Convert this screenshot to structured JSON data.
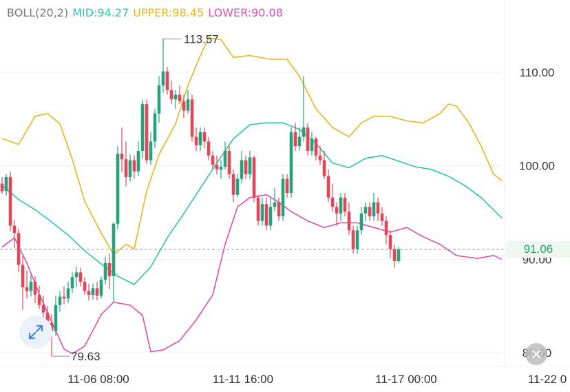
{
  "legend": {
    "indicator": "BOLL(20,2)",
    "mid": "MID:94.27",
    "upper": "UPPER:98.45",
    "lower": "LOWER:90.08"
  },
  "colors": {
    "up": "#26a17b",
    "down": "#e0485a",
    "mid": "#2cc3a8",
    "upper": "#e8b41e",
    "lower": "#d84fb0",
    "grid": "#eeeeee",
    "axis_text": "#333333",
    "indicator_text": "#777777",
    "current_price": "#2a9d6a"
  },
  "annotations": {
    "high": "113.57",
    "low": "79.63",
    "current_price": "91.06"
  },
  "icons": {
    "expand": "expand-arrows-icon",
    "reset": "reset-icon"
  },
  "chart_data": {
    "type": "candlestick",
    "y_ticks": [
      "110.00",
      "100.00",
      "90.00",
      "80.00"
    ],
    "x_ticks": [
      "11-06 08:00",
      "11-11 16:00",
      "11-17 00:00",
      "11-22 0"
    ],
    "ylim": [
      79,
      116
    ],
    "grid": true,
    "current_price": 91.06,
    "high": 113.57,
    "low": 79.63,
    "candles": [
      {
        "o": 98.1,
        "h": 98.8,
        "l": 97.0,
        "c": 97.3
      },
      {
        "o": 97.3,
        "h": 99.1,
        "l": 96.8,
        "c": 98.8
      },
      {
        "o": 98.8,
        "h": 99.4,
        "l": 93.0,
        "c": 93.6
      },
      {
        "o": 93.6,
        "h": 94.2,
        "l": 91.2,
        "c": 92.8
      },
      {
        "o": 92.8,
        "h": 93.3,
        "l": 88.6,
        "c": 89.4
      },
      {
        "o": 89.4,
        "h": 90.3,
        "l": 84.6,
        "c": 87.0
      },
      {
        "o": 87.0,
        "h": 88.8,
        "l": 85.8,
        "c": 86.6
      },
      {
        "o": 86.6,
        "h": 88.3,
        "l": 86.0,
        "c": 87.6
      },
      {
        "o": 87.6,
        "h": 88.2,
        "l": 85.3,
        "c": 86.2
      },
      {
        "o": 86.2,
        "h": 87.2,
        "l": 84.7,
        "c": 85.1
      },
      {
        "o": 85.1,
        "h": 86.1,
        "l": 83.5,
        "c": 84.3
      },
      {
        "o": 84.3,
        "h": 85.0,
        "l": 82.2,
        "c": 83.2
      },
      {
        "o": 83.2,
        "h": 84.1,
        "l": 79.6,
        "c": 82.3
      },
      {
        "o": 82.3,
        "h": 86.1,
        "l": 81.8,
        "c": 85.1
      },
      {
        "o": 85.1,
        "h": 86.6,
        "l": 84.4,
        "c": 86.0
      },
      {
        "o": 86.0,
        "h": 87.1,
        "l": 85.2,
        "c": 85.8
      },
      {
        "o": 85.8,
        "h": 87.6,
        "l": 85.3,
        "c": 86.9
      },
      {
        "o": 86.9,
        "h": 88.6,
        "l": 86.4,
        "c": 88.1
      },
      {
        "o": 88.1,
        "h": 89.2,
        "l": 87.0,
        "c": 88.6
      },
      {
        "o": 88.6,
        "h": 89.1,
        "l": 87.1,
        "c": 87.6
      },
      {
        "o": 87.6,
        "h": 88.1,
        "l": 86.2,
        "c": 86.6
      },
      {
        "o": 86.6,
        "h": 87.4,
        "l": 85.6,
        "c": 86.2
      },
      {
        "o": 86.2,
        "h": 87.4,
        "l": 85.7,
        "c": 86.9
      },
      {
        "o": 86.9,
        "h": 87.6,
        "l": 85.6,
        "c": 86.1
      },
      {
        "o": 86.1,
        "h": 88.2,
        "l": 85.8,
        "c": 87.8
      },
      {
        "o": 87.8,
        "h": 90.3,
        "l": 87.3,
        "c": 89.6
      },
      {
        "o": 89.6,
        "h": 90.6,
        "l": 86.8,
        "c": 88.2
      },
      {
        "o": 88.2,
        "h": 94.0,
        "l": 85.3,
        "c": 93.8
      },
      {
        "o": 93.8,
        "h": 102.1,
        "l": 93.2,
        "c": 101.3
      },
      {
        "o": 101.3,
        "h": 104.1,
        "l": 99.3,
        "c": 100.7
      },
      {
        "o": 100.7,
        "h": 102.6,
        "l": 97.8,
        "c": 98.8
      },
      {
        "o": 98.8,
        "h": 101.2,
        "l": 98.3,
        "c": 100.6
      },
      {
        "o": 100.6,
        "h": 101.1,
        "l": 98.6,
        "c": 99.4
      },
      {
        "o": 99.4,
        "h": 102.6,
        "l": 98.9,
        "c": 101.6
      },
      {
        "o": 101.6,
        "h": 107.1,
        "l": 100.8,
        "c": 106.6
      },
      {
        "o": 106.6,
        "h": 107.1,
        "l": 100.2,
        "c": 100.6
      },
      {
        "o": 100.6,
        "h": 103.6,
        "l": 100.1,
        "c": 102.6
      },
      {
        "o": 102.6,
        "h": 106.1,
        "l": 101.9,
        "c": 105.6
      },
      {
        "o": 105.6,
        "h": 109.6,
        "l": 104.6,
        "c": 108.6
      },
      {
        "o": 108.6,
        "h": 113.6,
        "l": 107.8,
        "c": 110.1
      },
      {
        "o": 110.1,
        "h": 110.6,
        "l": 107.6,
        "c": 108.1
      },
      {
        "o": 108.1,
        "h": 109.1,
        "l": 106.6,
        "c": 107.1
      },
      {
        "o": 107.1,
        "h": 108.1,
        "l": 106.1,
        "c": 107.6
      },
      {
        "o": 107.6,
        "h": 108.6,
        "l": 106.6,
        "c": 106.9
      },
      {
        "o": 106.9,
        "h": 107.6,
        "l": 105.1,
        "c": 105.9
      },
      {
        "o": 105.9,
        "h": 108.1,
        "l": 105.6,
        "c": 107.1
      },
      {
        "o": 107.1,
        "h": 107.6,
        "l": 102.6,
        "c": 103.1
      },
      {
        "o": 103.1,
        "h": 104.1,
        "l": 101.6,
        "c": 102.2
      },
      {
        "o": 102.2,
        "h": 104.1,
        "l": 101.6,
        "c": 103.6
      },
      {
        "o": 103.6,
        "h": 104.1,
        "l": 101.9,
        "c": 102.6
      },
      {
        "o": 102.6,
        "h": 103.1,
        "l": 100.6,
        "c": 101.1
      },
      {
        "o": 101.1,
        "h": 101.6,
        "l": 99.6,
        "c": 100.1
      },
      {
        "o": 100.1,
        "h": 101.1,
        "l": 99.1,
        "c": 99.6
      },
      {
        "o": 99.6,
        "h": 100.6,
        "l": 98.6,
        "c": 99.9
      },
      {
        "o": 99.9,
        "h": 102.6,
        "l": 99.6,
        "c": 101.6
      },
      {
        "o": 101.6,
        "h": 102.1,
        "l": 98.6,
        "c": 99.1
      },
      {
        "o": 99.1,
        "h": 99.6,
        "l": 96.1,
        "c": 96.9
      },
      {
        "o": 96.9,
        "h": 99.1,
        "l": 96.6,
        "c": 98.6
      },
      {
        "o": 98.6,
        "h": 101.6,
        "l": 98.1,
        "c": 100.6
      },
      {
        "o": 100.6,
        "h": 101.1,
        "l": 98.6,
        "c": 99.1
      },
      {
        "o": 99.1,
        "h": 101.6,
        "l": 98.6,
        "c": 100.9
      },
      {
        "o": 100.9,
        "h": 101.1,
        "l": 96.1,
        "c": 96.6
      },
      {
        "o": 96.6,
        "h": 96.9,
        "l": 93.6,
        "c": 94.1
      },
      {
        "o": 94.1,
        "h": 96.6,
        "l": 93.6,
        "c": 95.9
      },
      {
        "o": 95.9,
        "h": 96.6,
        "l": 93.1,
        "c": 93.6
      },
      {
        "o": 93.6,
        "h": 96.6,
        "l": 93.1,
        "c": 95.6
      },
      {
        "o": 95.6,
        "h": 97.6,
        "l": 95.1,
        "c": 96.1
      },
      {
        "o": 96.1,
        "h": 96.6,
        "l": 94.1,
        "c": 94.6
      },
      {
        "o": 94.6,
        "h": 99.1,
        "l": 94.1,
        "c": 98.6
      },
      {
        "o": 98.6,
        "h": 99.1,
        "l": 96.6,
        "c": 97.1
      },
      {
        "o": 97.1,
        "h": 104.1,
        "l": 96.6,
        "c": 103.6
      },
      {
        "o": 103.6,
        "h": 104.6,
        "l": 101.6,
        "c": 102.1
      },
      {
        "o": 102.1,
        "h": 104.1,
        "l": 101.6,
        "c": 103.1
      },
      {
        "o": 103.1,
        "h": 109.6,
        "l": 102.6,
        "c": 104.1
      },
      {
        "o": 104.1,
        "h": 104.6,
        "l": 101.1,
        "c": 101.6
      },
      {
        "o": 101.6,
        "h": 103.6,
        "l": 101.1,
        "c": 102.9
      },
      {
        "o": 102.9,
        "h": 103.1,
        "l": 100.6,
        "c": 101.1
      },
      {
        "o": 101.1,
        "h": 102.1,
        "l": 100.1,
        "c": 100.6
      },
      {
        "o": 100.6,
        "h": 101.6,
        "l": 98.6,
        "c": 98.9
      },
      {
        "o": 98.9,
        "h": 99.6,
        "l": 96.1,
        "c": 96.6
      },
      {
        "o": 96.6,
        "h": 98.1,
        "l": 95.1,
        "c": 95.6
      },
      {
        "o": 95.6,
        "h": 96.1,
        "l": 93.6,
        "c": 94.9
      },
      {
        "o": 94.9,
        "h": 97.1,
        "l": 94.1,
        "c": 96.6
      },
      {
        "o": 96.6,
        "h": 97.1,
        "l": 94.6,
        "c": 95.1
      },
      {
        "o": 95.1,
        "h": 96.1,
        "l": 92.6,
        "c": 93.1
      },
      {
        "o": 93.1,
        "h": 93.6,
        "l": 90.6,
        "c": 91.1
      },
      {
        "o": 91.1,
        "h": 93.6,
        "l": 90.6,
        "c": 93.1
      },
      {
        "o": 93.1,
        "h": 95.6,
        "l": 92.6,
        "c": 94.9
      },
      {
        "o": 94.9,
        "h": 96.1,
        "l": 94.1,
        "c": 95.6
      },
      {
        "o": 95.6,
        "h": 96.1,
        "l": 94.1,
        "c": 94.6
      },
      {
        "o": 94.6,
        "h": 97.1,
        "l": 94.1,
        "c": 96.1
      },
      {
        "o": 96.1,
        "h": 96.6,
        "l": 94.1,
        "c": 94.9
      },
      {
        "o": 94.9,
        "h": 95.6,
        "l": 93.6,
        "c": 94.1
      },
      {
        "o": 94.1,
        "h": 94.6,
        "l": 91.6,
        "c": 92.6
      },
      {
        "o": 92.6,
        "h": 93.1,
        "l": 90.1,
        "c": 91.1
      },
      {
        "o": 91.1,
        "h": 91.6,
        "l": 89.1,
        "c": 89.8
      },
      {
        "o": 89.8,
        "h": 91.3,
        "l": 89.6,
        "c": 91.06
      }
    ],
    "upper": [
      {
        "i": 0,
        "v": 102.9
      },
      {
        "i": 4,
        "v": 102.3
      },
      {
        "i": 8,
        "v": 105.3
      },
      {
        "i": 11,
        "v": 105.6
      },
      {
        "i": 14,
        "v": 104.5
      },
      {
        "i": 17,
        "v": 100.7
      },
      {
        "i": 20,
        "v": 96.2
      },
      {
        "i": 24,
        "v": 92.8
      },
      {
        "i": 27,
        "v": 90.5
      },
      {
        "i": 30,
        "v": 91.6
      },
      {
        "i": 32,
        "v": 91.1
      },
      {
        "i": 35,
        "v": 97.3
      },
      {
        "i": 38,
        "v": 101.2
      },
      {
        "i": 42,
        "v": 104.5
      },
      {
        "i": 45,
        "v": 108.6
      },
      {
        "i": 48,
        "v": 111.8
      },
      {
        "i": 50,
        "v": 113.7
      },
      {
        "i": 53,
        "v": 113.5
      },
      {
        "i": 56,
        "v": 111.6
      },
      {
        "i": 60,
        "v": 111.8
      },
      {
        "i": 65,
        "v": 111.4
      },
      {
        "i": 69,
        "v": 111.4
      },
      {
        "i": 72,
        "v": 109.6
      },
      {
        "i": 76,
        "v": 106.1
      },
      {
        "i": 80,
        "v": 104.1
      },
      {
        "i": 84,
        "v": 103.1
      },
      {
        "i": 87,
        "v": 104.6
      },
      {
        "i": 90,
        "v": 105.3
      },
      {
        "i": 94,
        "v": 105.3
      },
      {
        "i": 98,
        "v": 104.8
      },
      {
        "i": 102,
        "v": 104.6
      },
      {
        "i": 106,
        "v": 105.6
      },
      {
        "i": 108,
        "v": 106.6
      },
      {
        "i": 110,
        "v": 106.4
      },
      {
        "i": 113,
        "v": 104.6
      },
      {
        "i": 116,
        "v": 102.1
      },
      {
        "i": 119,
        "v": 99.1
      },
      {
        "i": 121,
        "v": 98.4
      }
    ],
    "mid": [
      {
        "i": 0,
        "v": 97.9
      },
      {
        "i": 4,
        "v": 96.4
      },
      {
        "i": 8,
        "v": 95.3
      },
      {
        "i": 12,
        "v": 94.0
      },
      {
        "i": 16,
        "v": 92.6
      },
      {
        "i": 20,
        "v": 90.9
      },
      {
        "i": 24,
        "v": 89.5
      },
      {
        "i": 28,
        "v": 88.2
      },
      {
        "i": 32,
        "v": 87.3
      },
      {
        "i": 36,
        "v": 89.2
      },
      {
        "i": 40,
        "v": 92.3
      },
      {
        "i": 44,
        "v": 94.9
      },
      {
        "i": 48,
        "v": 97.6
      },
      {
        "i": 52,
        "v": 100.3
      },
      {
        "i": 56,
        "v": 102.9
      },
      {
        "i": 60,
        "v": 104.4
      },
      {
        "i": 64,
        "v": 104.6
      },
      {
        "i": 68,
        "v": 104.6
      },
      {
        "i": 72,
        "v": 103.9
      },
      {
        "i": 76,
        "v": 102.4
      },
      {
        "i": 80,
        "v": 100.3
      },
      {
        "i": 84,
        "v": 99.8
      },
      {
        "i": 88,
        "v": 100.8
      },
      {
        "i": 92,
        "v": 101.1
      },
      {
        "i": 96,
        "v": 100.5
      },
      {
        "i": 100,
        "v": 99.9
      },
      {
        "i": 104,
        "v": 99.6
      },
      {
        "i": 108,
        "v": 98.9
      },
      {
        "i": 112,
        "v": 97.9
      },
      {
        "i": 116,
        "v": 96.6
      },
      {
        "i": 121,
        "v": 94.4
      }
    ],
    "lower": [
      {
        "i": 0,
        "v": 91.3
      },
      {
        "i": 3,
        "v": 92.3
      },
      {
        "i": 6,
        "v": 89.6
      },
      {
        "i": 9,
        "v": 86.3
      },
      {
        "i": 12,
        "v": 83.3
      },
      {
        "i": 15,
        "v": 80.4
      },
      {
        "i": 17,
        "v": 79.9
      },
      {
        "i": 20,
        "v": 80.7
      },
      {
        "i": 24,
        "v": 84.1
      },
      {
        "i": 27,
        "v": 85.4
      },
      {
        "i": 31,
        "v": 85.1
      },
      {
        "i": 34,
        "v": 84.0
      },
      {
        "i": 36,
        "v": 80.1
      },
      {
        "i": 39,
        "v": 80.3
      },
      {
        "i": 43,
        "v": 81.3
      },
      {
        "i": 47,
        "v": 83.5
      },
      {
        "i": 51,
        "v": 86.2
      },
      {
        "i": 54,
        "v": 91.6
      },
      {
        "i": 57,
        "v": 95.6
      },
      {
        "i": 60,
        "v": 96.6
      },
      {
        "i": 64,
        "v": 96.9
      },
      {
        "i": 67,
        "v": 96.1
      },
      {
        "i": 70,
        "v": 95.1
      },
      {
        "i": 74,
        "v": 94.1
      },
      {
        "i": 78,
        "v": 93.4
      },
      {
        "i": 82,
        "v": 93.9
      },
      {
        "i": 86,
        "v": 93.9
      },
      {
        "i": 90,
        "v": 93.4
      },
      {
        "i": 94,
        "v": 92.9
      },
      {
        "i": 98,
        "v": 93.4
      },
      {
        "i": 102,
        "v": 92.4
      },
      {
        "i": 106,
        "v": 91.6
      },
      {
        "i": 110,
        "v": 90.4
      },
      {
        "i": 115,
        "v": 90.1
      },
      {
        "i": 119,
        "v": 90.4
      },
      {
        "i": 121,
        "v": 90.0
      }
    ]
  }
}
